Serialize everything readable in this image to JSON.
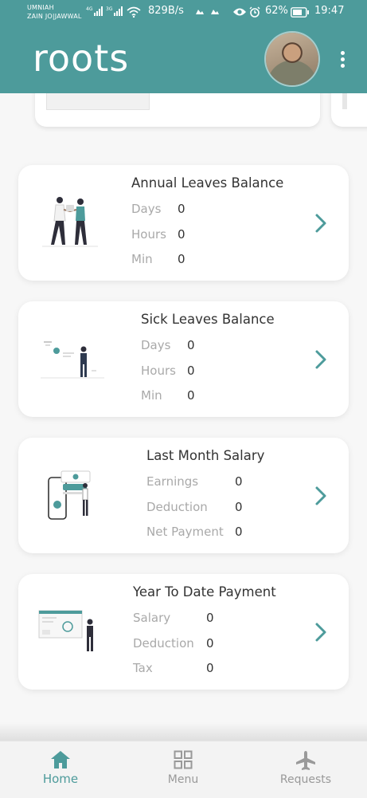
{
  "status_bar": {
    "carrier_1": "UMNIAH",
    "carrier_2": "ZAIN JO|JAWWAL",
    "net_speed": "829B/s",
    "battery": "62%",
    "time": "19:47"
  },
  "header": {
    "logo": "roots"
  },
  "cards": [
    {
      "title": "Annual Leaves Balance",
      "rows": [
        {
          "label": "Days",
          "value": "0"
        },
        {
          "label": "Hours",
          "value": "0"
        },
        {
          "label": "Min",
          "value": "0"
        }
      ]
    },
    {
      "title": "Sick Leaves Balance",
      "rows": [
        {
          "label": "Days",
          "value": "0"
        },
        {
          "label": "Hours",
          "value": "0"
        },
        {
          "label": "Min",
          "value": "0"
        }
      ]
    },
    {
      "title": "Last Month Salary",
      "rows": [
        {
          "label": "Earnings",
          "value": "0"
        },
        {
          "label": "Deduction",
          "value": "0"
        },
        {
          "label": "Net Payment",
          "value": "0"
        }
      ]
    },
    {
      "title": "Year To Date Payment",
      "rows": [
        {
          "label": "Salary",
          "value": "0"
        },
        {
          "label": "Deduction",
          "value": "0"
        },
        {
          "label": "Tax",
          "value": "0"
        }
      ]
    }
  ],
  "bottom_nav": {
    "items": [
      {
        "label": "Home",
        "icon": "home-icon",
        "active": true
      },
      {
        "label": "Menu",
        "icon": "grid-menu-icon",
        "active": false
      },
      {
        "label": "Requests",
        "icon": "airplane-icon",
        "active": false
      }
    ]
  },
  "colors": {
    "brand": "#4d9b9b",
    "background": "#f7f7f7",
    "card": "#ffffff",
    "label_gray": "#a9a9a9"
  }
}
